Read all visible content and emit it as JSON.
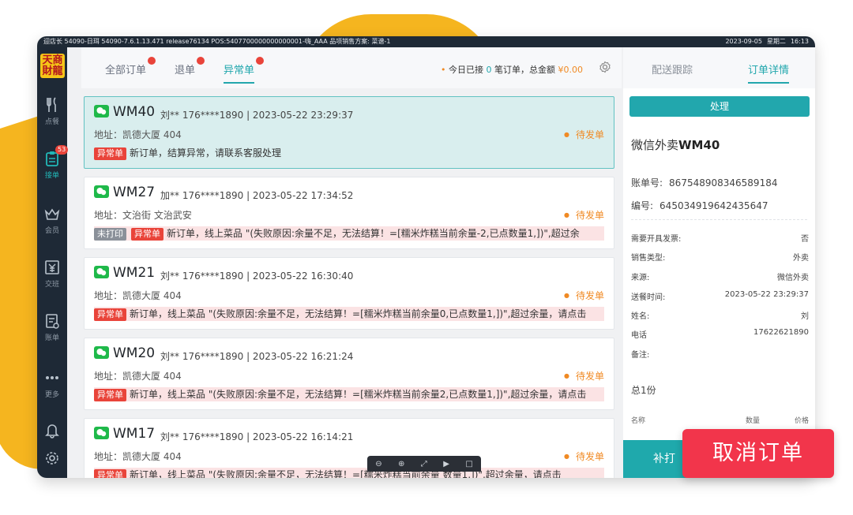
{
  "statusbar": {
    "left": "迎店长 54090-日珥 54090-7.6.1.13.471 release76134 POS:5407700000000000001-嗨_AAA 品项销售方案: 菜谱-1",
    "date": "2023-09-05",
    "weekday": "星期二",
    "time": "16:13"
  },
  "logo": "天商財龍",
  "sidebar": {
    "items": [
      {
        "label": "点餐",
        "icon": "fork-knife-icon"
      },
      {
        "label": "接单",
        "icon": "clipboard-icon",
        "badge": "53"
      },
      {
        "label": "会员",
        "icon": "crown-icon"
      },
      {
        "label": "交班",
        "icon": "yen-register-icon"
      },
      {
        "label": "账单",
        "icon": "bill-icon"
      },
      {
        "label": "更多",
        "icon": "more-icon"
      }
    ],
    "bell_icon": "bell-icon",
    "settings_icon": "gear-icon"
  },
  "tabs": [
    {
      "label": "全部订单"
    },
    {
      "label": "退单"
    },
    {
      "label": "异常单"
    }
  ],
  "summary": {
    "prefix": "今日已接",
    "count": "0",
    "middle": "笔订单，总金额",
    "amount": "¥0.00"
  },
  "orders": [
    {
      "code": "WM40",
      "meta": "刘** 176****1890 | 2023-05-22 23:29:37",
      "address": "地址：凯德大厦 404",
      "status": "待发单",
      "not_printed": "",
      "tag": "异常单",
      "message": "新订单，结算异常，请联系客服处理"
    },
    {
      "code": "WM27",
      "meta": "加** 176****1890 | 2023-05-22 17:34:52",
      "address": "地址：文治街 文治武安",
      "status": "待发单",
      "not_printed": "未打印",
      "tag": "异常单",
      "message": "新订单，线上菜品 \"(失败原因:余量不足，无法结算！=[糯米炸糕当前余量-2,已点数量1,])\",超过余"
    },
    {
      "code": "WM21",
      "meta": "刘** 176****1890 | 2023-05-22 16:30:40",
      "address": "地址：凯德大厦 404",
      "status": "待发单",
      "not_printed": "",
      "tag": "异常单",
      "message": "新订单，线上菜品 \"(失败原因:余量不足，无法结算！=[糯米炸糕当前余量0,已点数量1,])\",超过余量，请点击"
    },
    {
      "code": "WM20",
      "meta": "刘** 176****1890 | 2023-05-22 16:21:24",
      "address": "地址：凯德大厦 404",
      "status": "待发单",
      "not_printed": "",
      "tag": "异常单",
      "message": "新订单，线上菜品 \"(失败原因:余量不足，无法结算！=[糯米炸糕当前余量2,已点数量1,])\",超过余量，请点击"
    },
    {
      "code": "WM17",
      "meta": "刘** 176****1890 | 2023-05-22 16:14:21",
      "address": "地址：凯德大厦 404",
      "status": "待发单",
      "not_printed": "",
      "tag": "异常单",
      "message": "新订单，线上菜品 \"(失败原因:余量不足，无法结算！=[糯米炸糕当前余量 数量1,])\",超过余量，请点击"
    }
  ],
  "right_panel": {
    "tabs": [
      {
        "label": "配送跟踪"
      },
      {
        "label": "订单详情"
      }
    ],
    "handle_label": "处理",
    "title_prefix": "微信外卖",
    "title_code": "WM40",
    "bill_no_label": "账单号:",
    "bill_no": "867548908346589184",
    "serial_label": "编号:",
    "serial": "645034919642435647",
    "fields": [
      {
        "k": "需要开具发票:",
        "v": "否"
      },
      {
        "k": "销售类型:",
        "v": "外卖"
      },
      {
        "k": "来源:",
        "v": "微信外卖"
      },
      {
        "k": "送餐时间:",
        "v": "2023-05-22 23:29:37"
      },
      {
        "k": "姓名:",
        "v": "刘"
      },
      {
        "k": "电话",
        "v": "17622621890"
      },
      {
        "k": "备注:",
        "v": ""
      }
    ],
    "total": "总1份",
    "table_headers": {
      "name": "名称",
      "qty": "数量",
      "price": "价格"
    },
    "bottom_button": "补打"
  },
  "cancel_button": "取消订单",
  "colors": {
    "accent": "#22a7ad",
    "warn": "#f08a24",
    "error": "#e9443a",
    "brand_yellow": "#f5b51f",
    "cancel_red": "#f2354b"
  }
}
